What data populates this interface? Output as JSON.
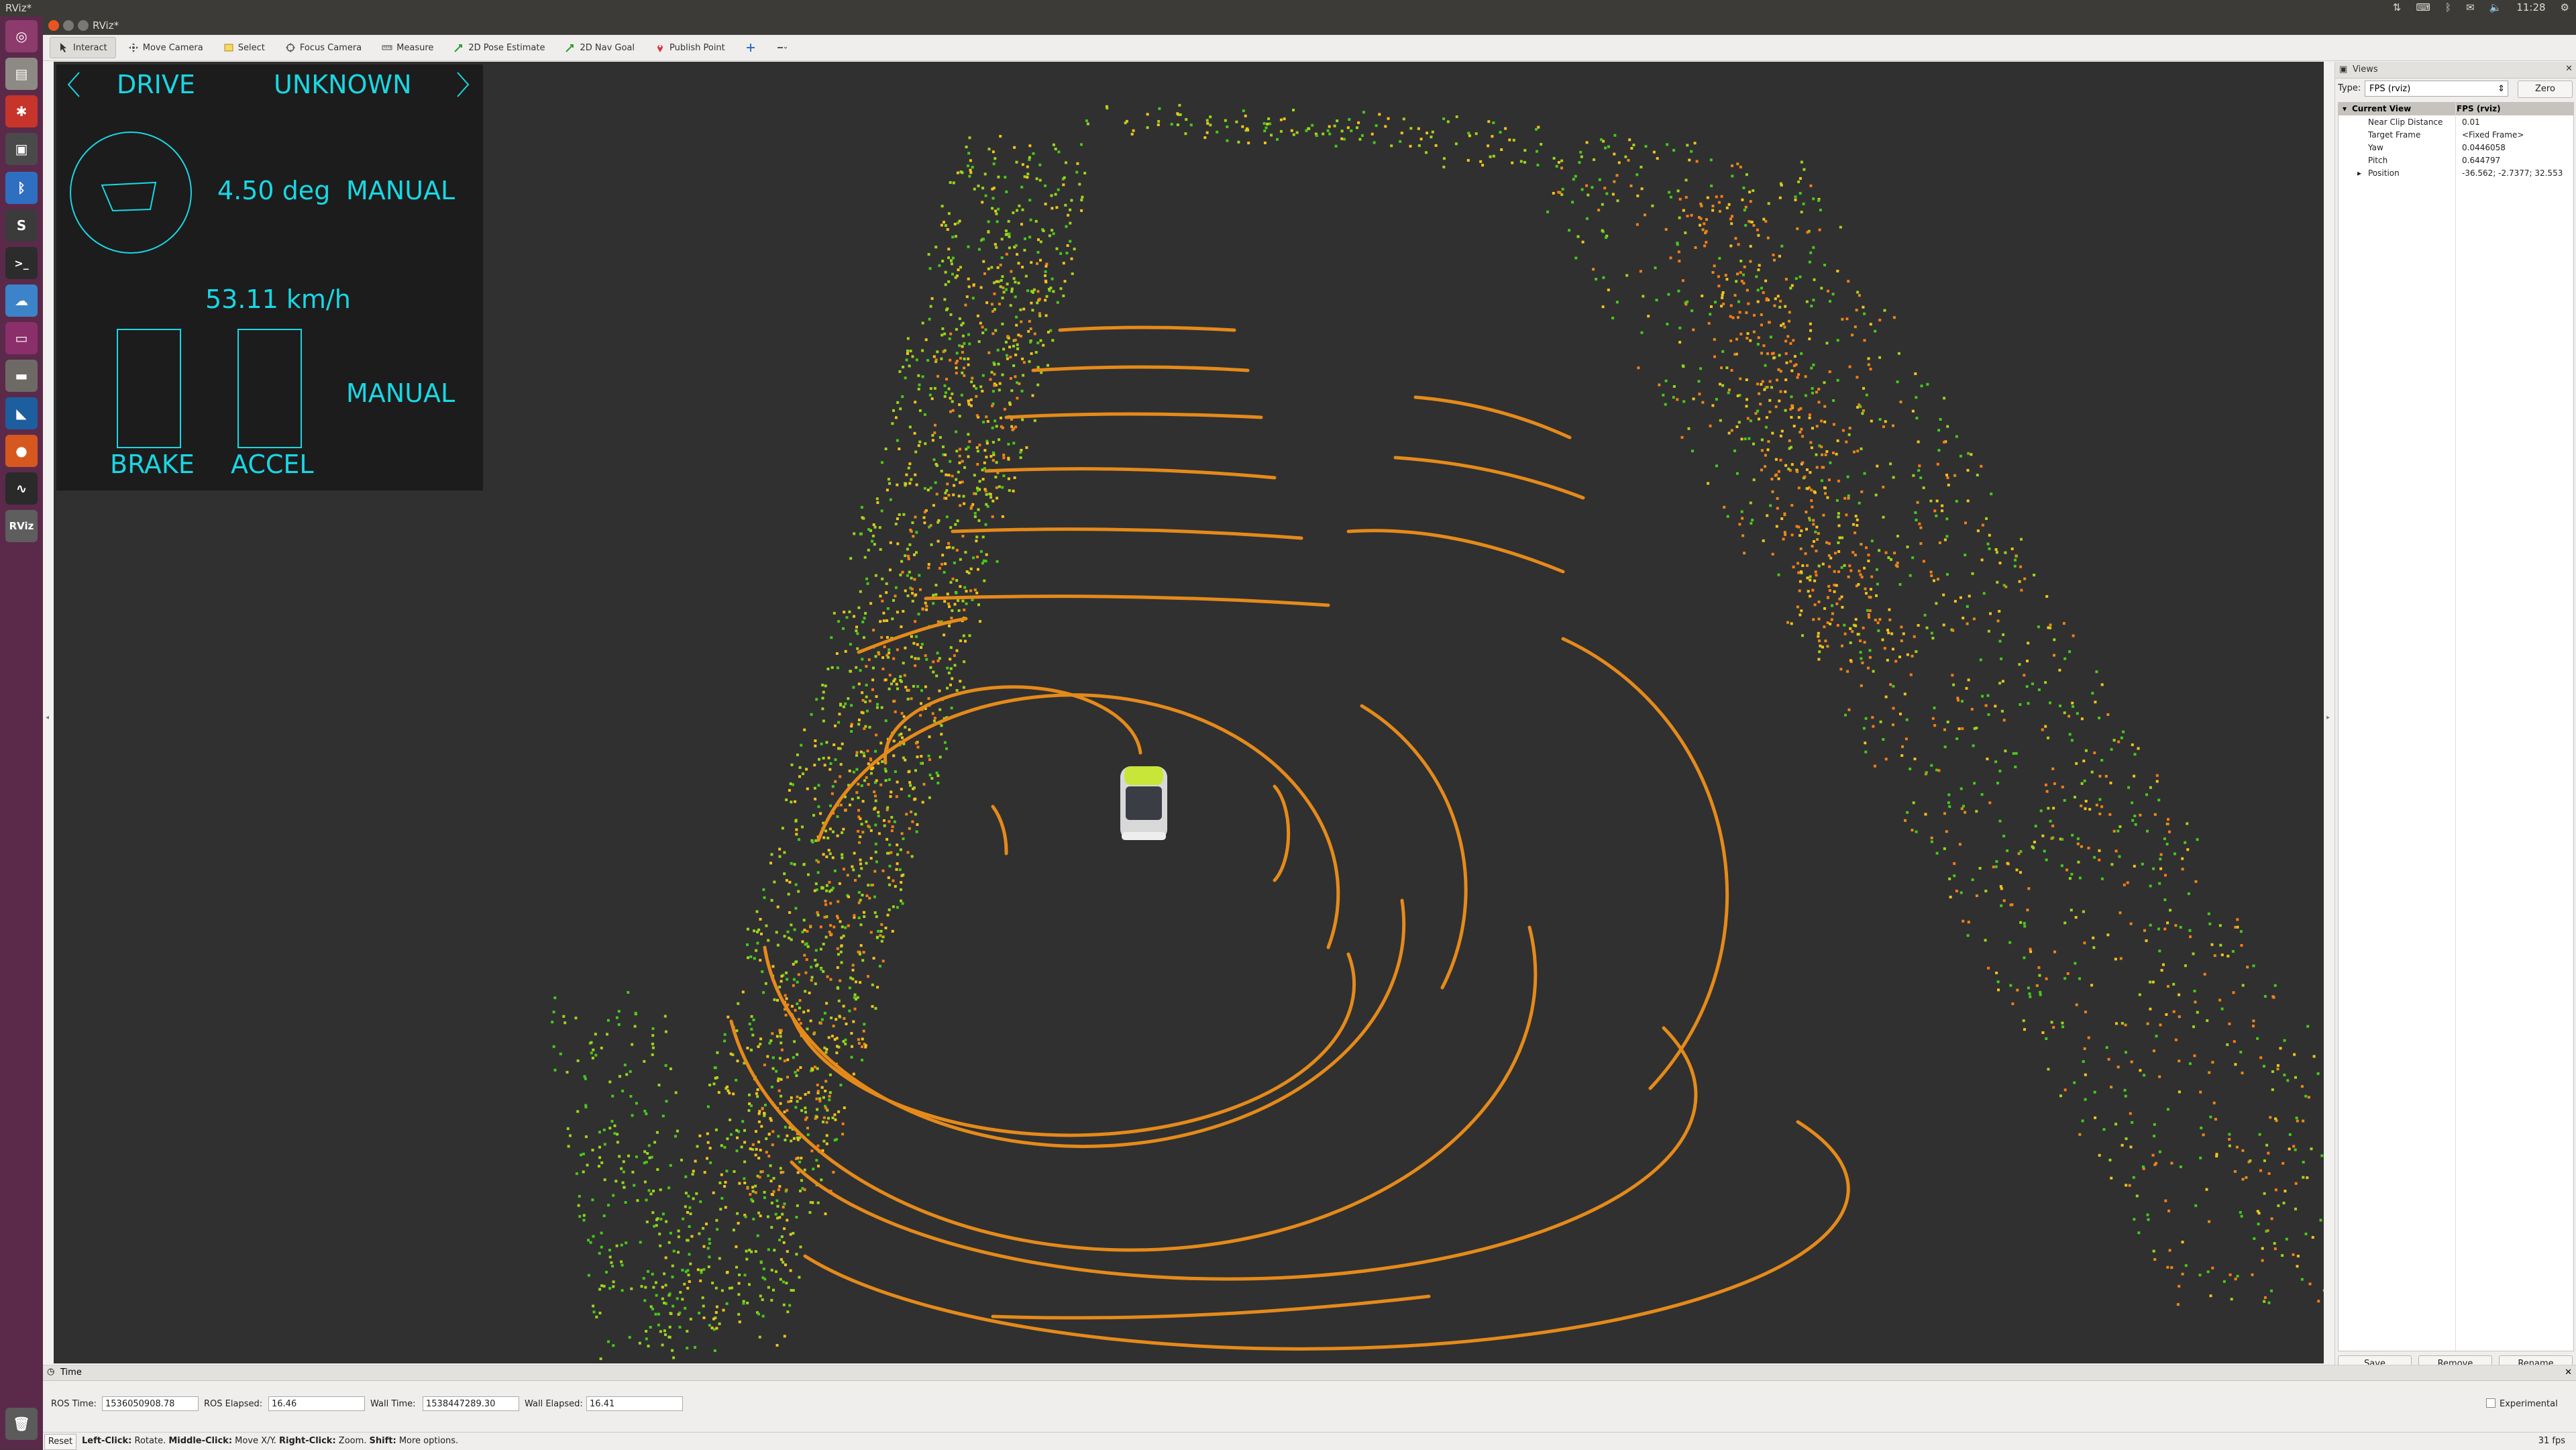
{
  "system_bar": {
    "title": "RViz*",
    "clock": "11:28"
  },
  "window": {
    "title": "RViz*"
  },
  "toolbar": {
    "interact": "Interact",
    "move_camera": "Move Camera",
    "select": "Select",
    "focus_camera": "Focus Camera",
    "measure": "Measure",
    "pose_estimate": "2D Pose Estimate",
    "nav_goal": "2D Nav Goal",
    "publish_point": "Publish Point"
  },
  "hud": {
    "gear": "DRIVE",
    "state": "UNKNOWN",
    "steering": "4.50 deg",
    "steer_mode": "MANUAL",
    "speed": "53.11 km/h",
    "pedal_mode": "MANUAL",
    "brake_label": "BRAKE",
    "accel_label": "ACCEL",
    "accent_color": "#19d7e3"
  },
  "views_panel": {
    "title": "Views",
    "type_label": "Type:",
    "type_value": "FPS (rviz)",
    "zero_button": "Zero",
    "current_view_label": "Current View",
    "current_view_value": "FPS (rviz)",
    "properties": [
      {
        "key": "Near Clip Distance",
        "value": "0.01"
      },
      {
        "key": "Target Frame",
        "value": "<Fixed Frame>"
      },
      {
        "key": "Yaw",
        "value": "0.0446058"
      },
      {
        "key": "Pitch",
        "value": "0.644797"
      },
      {
        "key": "Position",
        "value": "-36.562; -2.7377; 32.553"
      }
    ],
    "save_button": "Save",
    "remove_button": "Remove",
    "rename_button": "Rename"
  },
  "time_panel": {
    "title": "Time",
    "ros_time_label": "ROS Time:",
    "ros_time": "1536050908.78",
    "ros_elapsed_label": "ROS Elapsed:",
    "ros_elapsed": "16.46",
    "wall_time_label": "Wall Time:",
    "wall_time": "1538447289.30",
    "wall_elapsed_label": "Wall Elapsed:",
    "wall_elapsed": "16.41",
    "experimental_label": "Experimental"
  },
  "status_bar": {
    "reset_button": "Reset",
    "left_click": "Left-Click:",
    "left_click_desc": " Rotate. ",
    "middle_click": "Middle-Click:",
    "middle_click_desc": " Move X/Y. ",
    "right_click": "Right-Click:",
    "right_click_desc": " Zoom. ",
    "shift": "Shift:",
    "shift_desc": " More options.",
    "fps": "31 fps"
  },
  "launcher_icons": [
    "ubuntu-icon",
    "files-icon",
    "settings-icon",
    "system-icon",
    "bluetooth-icon",
    "sublime-icon",
    "terminal-icon",
    "cloud-icon",
    "screenshot-icon",
    "drive-icon",
    "vscode-icon",
    "firefox-icon",
    "monitor-icon",
    "rviz-icon",
    "trash-icon"
  ],
  "lidar_colors": [
    "#e58a1a",
    "#f2c21d",
    "#9bd41c",
    "#45c81c",
    "#ff7a14"
  ]
}
